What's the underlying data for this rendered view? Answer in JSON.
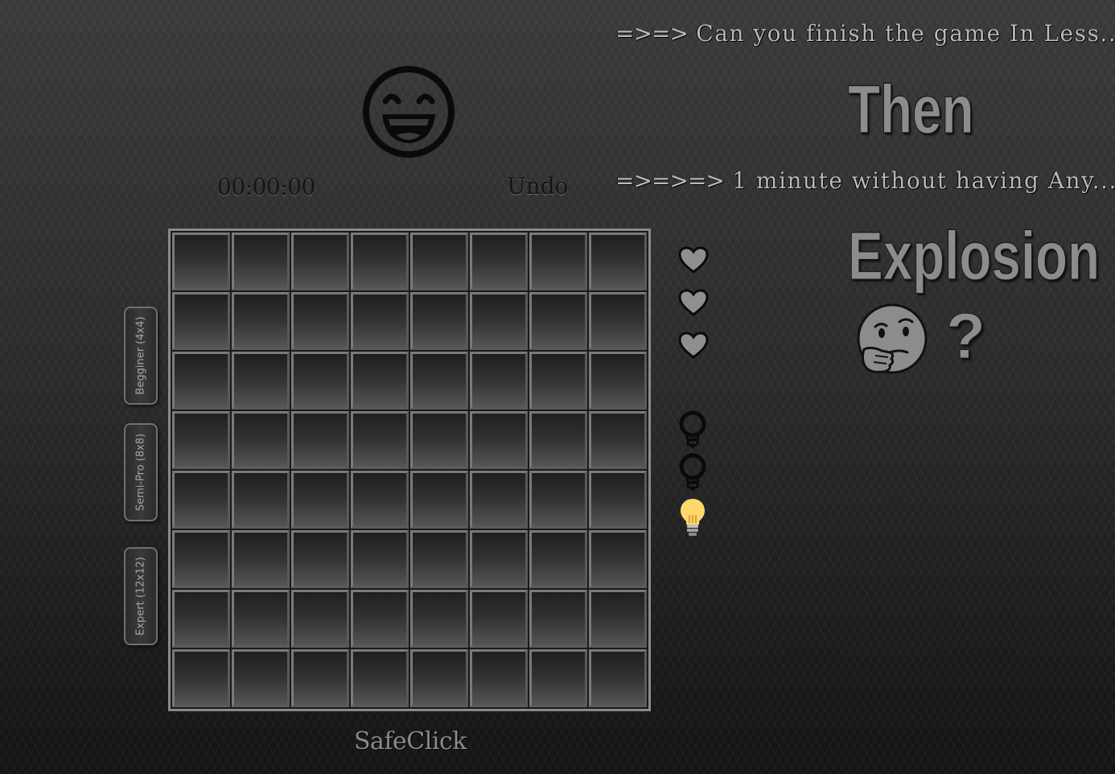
{
  "header": {
    "face_icon": "grinning-face-icon",
    "timer": "00:00:00",
    "undo_label": "Undo"
  },
  "levels": [
    {
      "label": "Begginer (4x4)"
    },
    {
      "label": "Semi-Pro (8x8)"
    },
    {
      "label": "Expert (12x12)"
    }
  ],
  "board": {
    "rows": 8,
    "cols": 8
  },
  "lives": {
    "icon": "heart-icon",
    "count": 3,
    "color": "#8f8f8f"
  },
  "hints": {
    "icon": "lightbulb-icon",
    "total": 3,
    "available": 1,
    "lit_color": "#ffd86b"
  },
  "right_panel": {
    "line1_arrows": "=>=>",
    "line1_text": "Can you finish the game In Less...",
    "word1": "Then",
    "line2_arrows": "=>=>=>",
    "line2_text": "1 minute without having Any...",
    "word2": "Explosion",
    "thinking_icon": "thinking-face-icon",
    "question": "?"
  },
  "footer": {
    "title": "SafeClick"
  }
}
